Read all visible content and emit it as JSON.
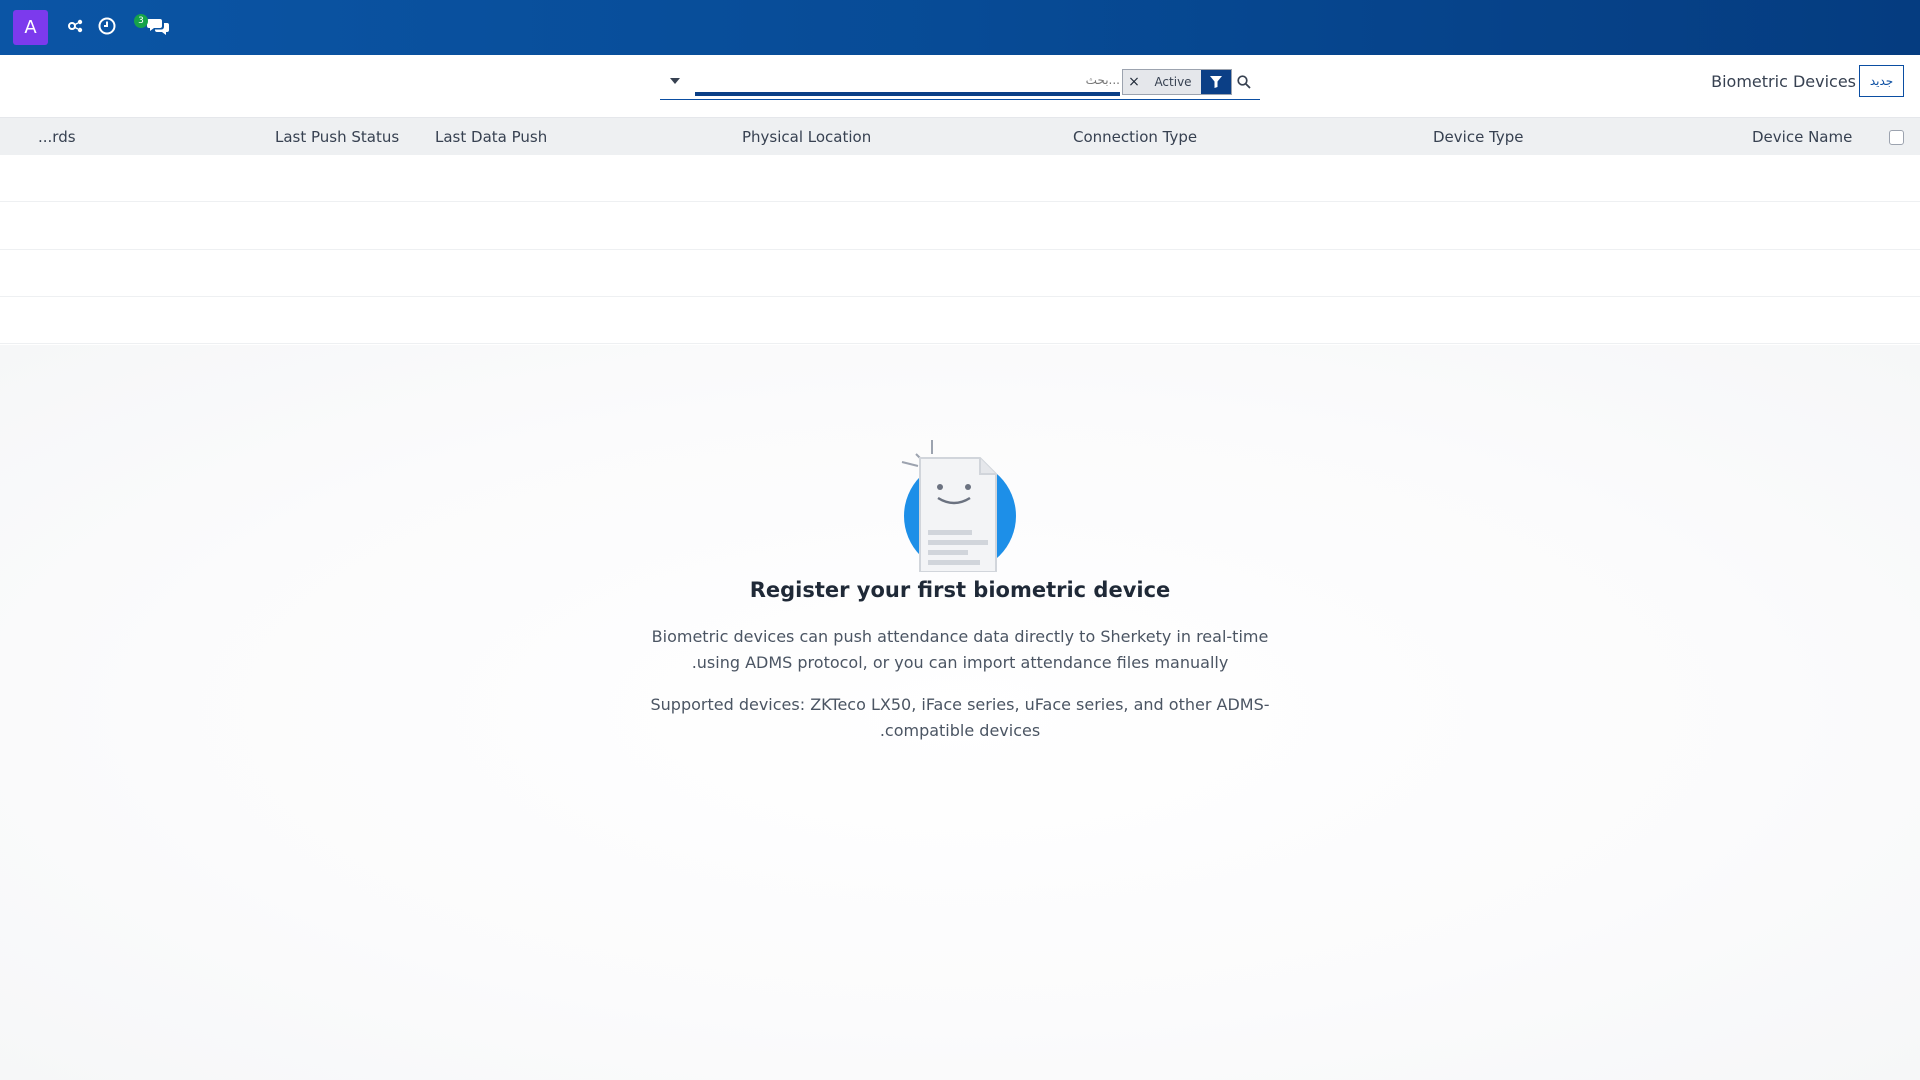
{
  "navbar": {
    "avatar_letter": "A",
    "messages_badge": "3"
  },
  "control": {
    "title": "Biometric Devices",
    "new_button": "جديد",
    "search_placeholder": "بحث...",
    "facet_value": "Active",
    "facet_remove": "×"
  },
  "table": {
    "columns": {
      "records": "...rds",
      "last_push_status": "Last Push Status",
      "last_data_push": "Last Data Push",
      "physical_location": "Physical Location",
      "connection_type": "Connection Type",
      "device_type": "Device Type",
      "device_name": "Device Name"
    }
  },
  "empty_state": {
    "title": "Register your first biometric device",
    "line1": "Biometric devices can push attendance data directly to Sherkety in real-time",
    "line2": ".using ADMS protocol, or you can import attendance files manually",
    "line3": "Supported devices: ZKTeco LX50, iFace series, uFace series, and other ADMS-",
    "line4": ".compatible devices"
  },
  "colors": {
    "navbar_start": "#0b55a5",
    "navbar_end": "#053c80",
    "avatar": "#7c3aed",
    "badge": "#16a34a",
    "accent": "#0b4ea2",
    "illustration_blue": "#1d8fe8"
  },
  "icons": {
    "navbar": [
      "settings-network-icon",
      "clock-icon",
      "chat-icon"
    ],
    "search": "search-icon",
    "filter": "filter-icon",
    "dropdown": "caret-down-icon"
  }
}
